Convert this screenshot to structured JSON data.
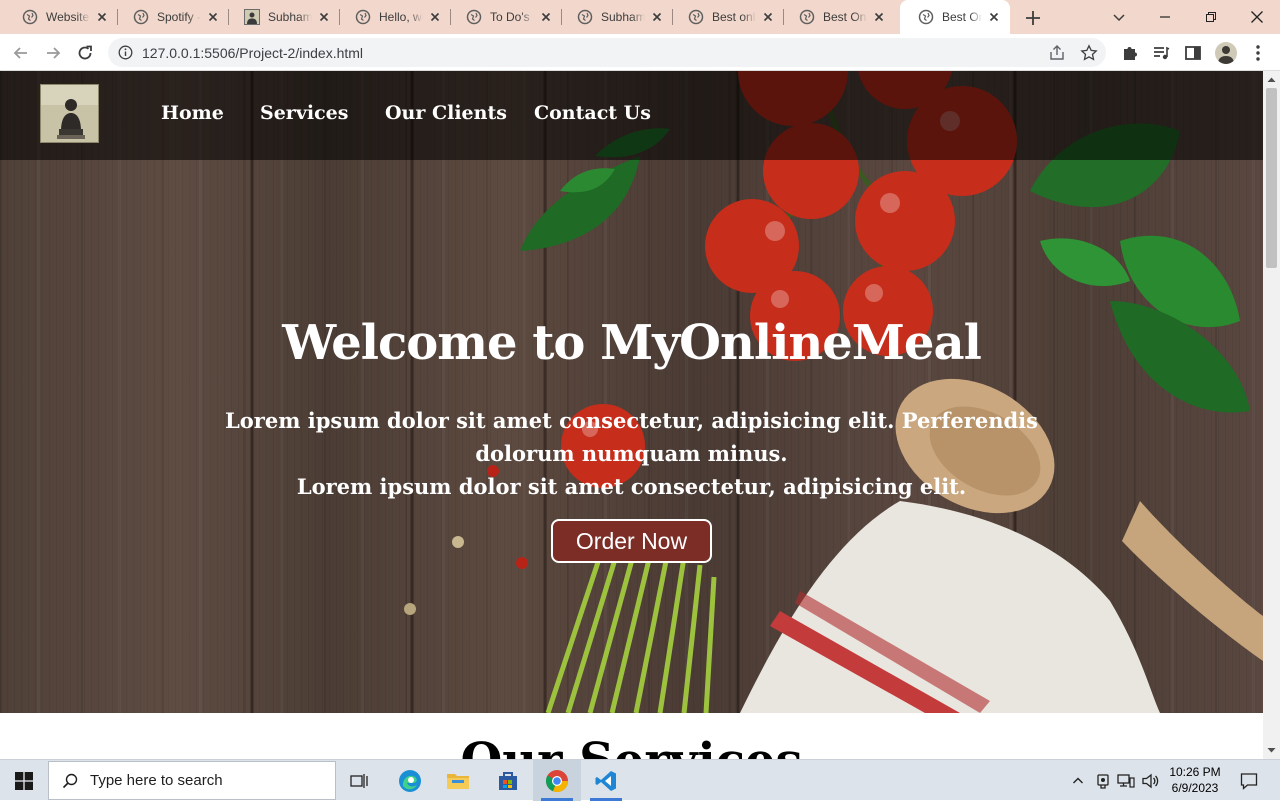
{
  "browser": {
    "tabs": [
      {
        "title": "Website",
        "icon": "globe-icon",
        "active": false
      },
      {
        "title": "Spotify -",
        "icon": "globe-icon",
        "active": false
      },
      {
        "title": "Subham",
        "icon": "profile-photo-icon",
        "active": false
      },
      {
        "title": "Hello, wo",
        "icon": "globe-icon",
        "active": false
      },
      {
        "title": "To Do's l",
        "icon": "globe-icon",
        "active": false
      },
      {
        "title": "Subham",
        "icon": "globe-icon",
        "active": false
      },
      {
        "title": "Best onli",
        "icon": "globe-icon",
        "active": false
      },
      {
        "title": "Best Onl",
        "icon": "globe-icon",
        "active": false
      },
      {
        "title": "Best Onl",
        "icon": "globe-icon",
        "active": true
      }
    ],
    "url": "127.0.0.1:5506/Project-2/index.html",
    "tabstrip_color": "#f2d8cc"
  },
  "page": {
    "nav": {
      "links": [
        "Home",
        "Services",
        "Our Clients",
        "Contact Us"
      ]
    },
    "hero": {
      "title": "Welcome to MyOnlineMeal",
      "text_1": "Lorem ipsum dolor sit amet consectetur, adipisicing elit. Perferendis dolorum numquam minus.",
      "text_2": "Lorem ipsum dolor sit amet consectetur, adipisicing elit.",
      "button_label": "Order Now",
      "button_color": "#7b2d26"
    },
    "section_heading": "Our Services"
  },
  "taskbar": {
    "search_placeholder": "Type here to search",
    "apps": [
      "task-view-icon",
      "edge-icon",
      "file-explorer-icon",
      "store-icon",
      "chrome-icon",
      "vscode-icon"
    ],
    "time": "10:26 PM",
    "date": "6/9/2023"
  }
}
